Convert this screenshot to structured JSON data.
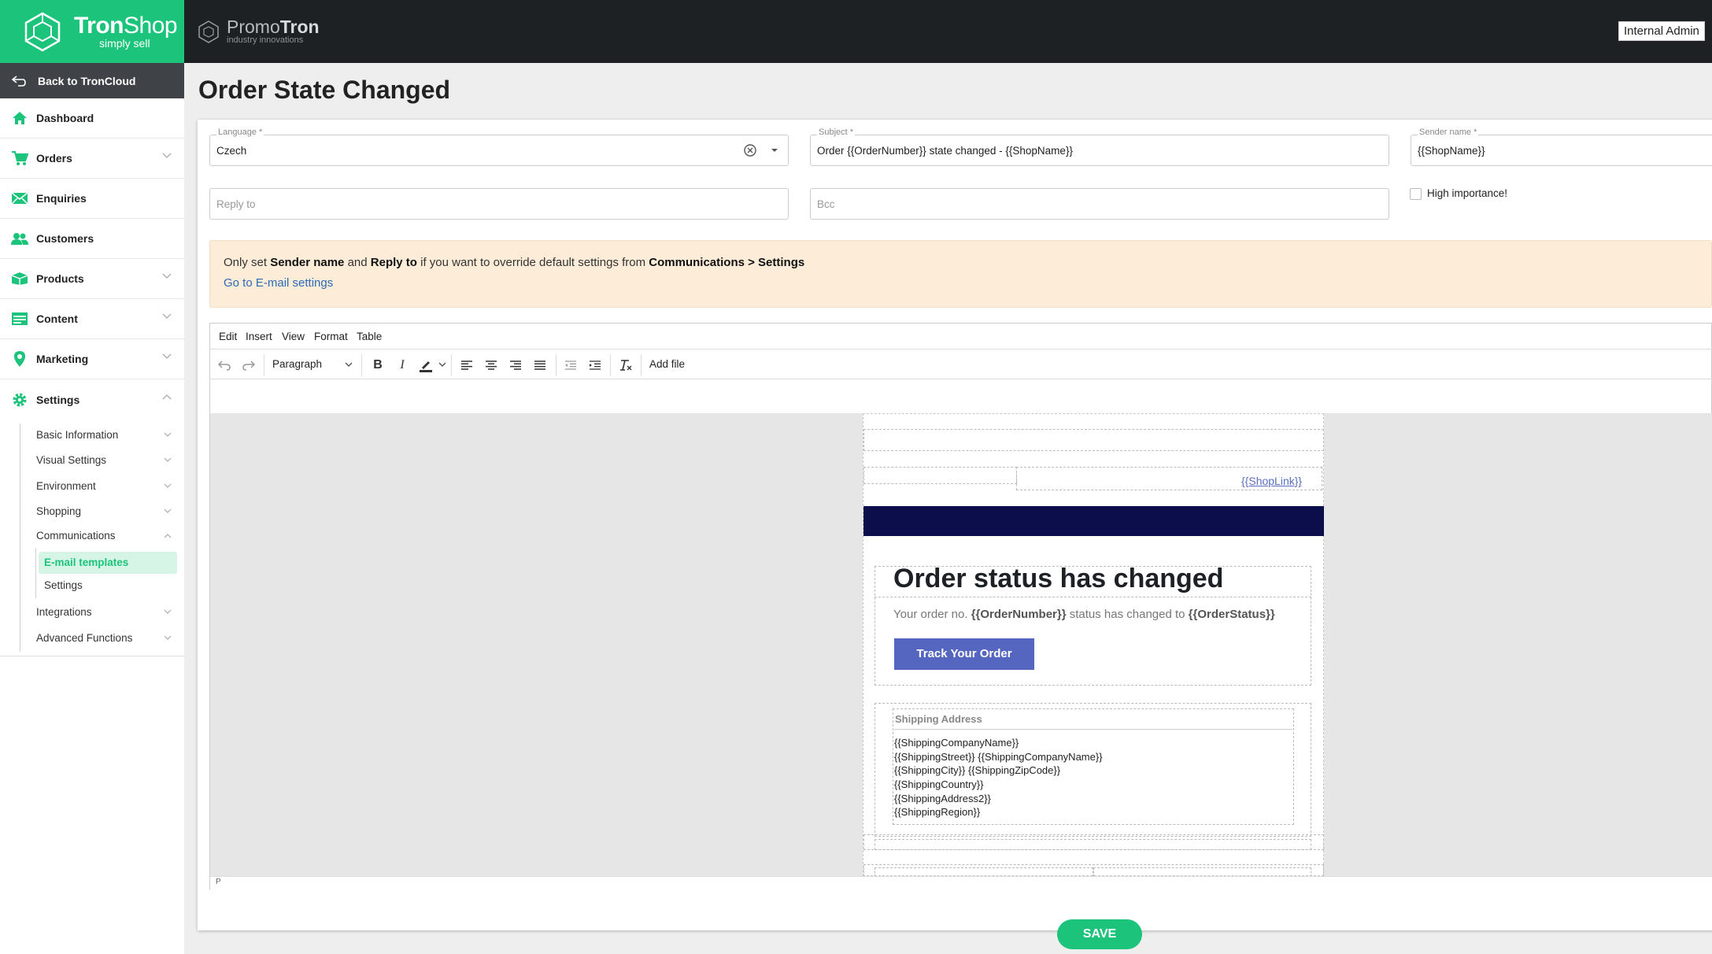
{
  "brand": {
    "name_bold": "Tron",
    "name_rest": "Shop",
    "tagline": "simply sell",
    "accent": "#1cc47b",
    "topbar_color": "#1e2124"
  },
  "promo": {
    "name_light": "Promo",
    "name_bold": "Tron",
    "tagline": "industry innovations"
  },
  "header": {
    "user": "Internal Admin"
  },
  "sidebar": {
    "back": "Back to TronCloud",
    "items": [
      {
        "label": "Dashboard",
        "icon": "home-icon"
      },
      {
        "label": "Orders",
        "icon": "cart-icon"
      },
      {
        "label": "Enquiries",
        "icon": "envelope-icon"
      },
      {
        "label": "Customers",
        "icon": "users-icon"
      },
      {
        "label": "Products",
        "icon": "box-icon"
      },
      {
        "label": "Content",
        "icon": "content-icon"
      },
      {
        "label": "Marketing",
        "icon": "pin-icon"
      },
      {
        "label": "Settings",
        "icon": "gear-icon"
      }
    ],
    "settings_sub": [
      "Basic Information",
      "Visual Settings",
      "Environment",
      "Shopping",
      "Communications",
      "Integrations",
      "Advanced Functions"
    ],
    "communications_sub": {
      "active": "E-mail templates",
      "other": "Settings"
    }
  },
  "page": {
    "title": "Order State Changed"
  },
  "form": {
    "language": {
      "label": "Language *",
      "value": "Czech"
    },
    "subject": {
      "label": "Subject *",
      "value": "Order {{OrderNumber}} state changed - {{ShopName}}"
    },
    "sender": {
      "label": "Sender name *",
      "value": "{{ShopName}}"
    },
    "reply_to": {
      "placeholder": "Reply to"
    },
    "bcc": {
      "placeholder": "Bcc"
    },
    "high_importance": {
      "label": "High importance!",
      "checked": false
    }
  },
  "notice": {
    "p1": "Only set ",
    "b1": "Sender name",
    "p2": " and ",
    "b2": "Reply to",
    "p3": " if you want to override default settings from ",
    "b3": "Communications > Settings",
    "link": "Go to E-mail settings"
  },
  "editor": {
    "menus": [
      "Edit",
      "Insert",
      "View",
      "Format",
      "Table"
    ],
    "block_format": "Paragraph",
    "add_file": "Add file",
    "status_path": "P"
  },
  "email": {
    "shop_link": "{{ShopLink}}",
    "heading": "Order status has changed",
    "line_prefix": "Your order no. ",
    "order_number": "{{OrderNumber}}",
    "line_mid": " status has changed to ",
    "order_status": "{{OrderStatus}}",
    "button": "Track Your Order",
    "shipping_title": "Shipping Address",
    "shipping_lines": [
      "{{ShippingCompanyName}}",
      "{{ShippingStreet}} {{ShippingCompanyName}}",
      "{{ShippingCity}} {{ShippingZipCode}}",
      "{{ShippingCountry}}",
      "{{ShippingAddress2}}",
      "{{ShippingRegion}}"
    ],
    "header_color": "#0b0e4a",
    "button_color": "#5566c0"
  },
  "actions": {
    "save": "SAVE"
  }
}
